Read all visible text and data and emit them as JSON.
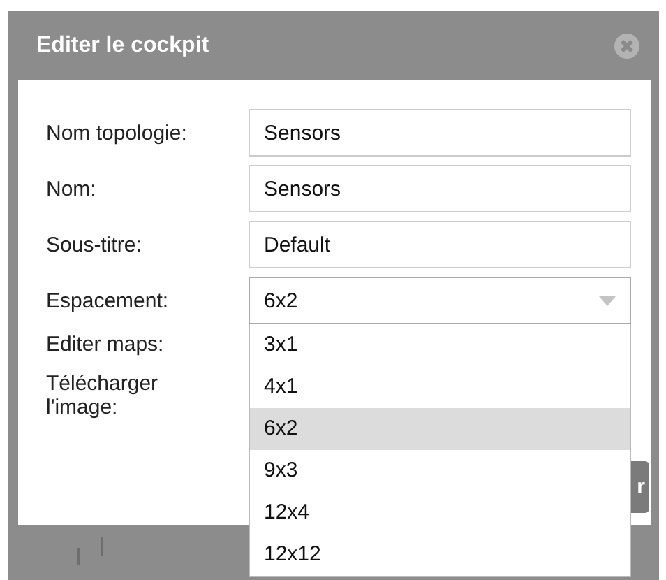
{
  "dialog": {
    "title": "Editer le cockpit",
    "fields": [
      {
        "kind": "text",
        "label": "Nom topologie:",
        "value": "Sensors"
      },
      {
        "kind": "text",
        "label": "Nom:",
        "value": "Sensors"
      },
      {
        "kind": "text",
        "label": "Sous-titre:",
        "value": "Default"
      },
      {
        "kind": "select",
        "label": "Espacement:",
        "value": "6x2",
        "expanded": true,
        "options": [
          {
            "label": "3x1",
            "selected": false
          },
          {
            "label": "4x1",
            "selected": false
          },
          {
            "label": "6x2",
            "selected": true
          },
          {
            "label": "9x3",
            "selected": false
          },
          {
            "label": "12x4",
            "selected": false
          },
          {
            "label": "12x12",
            "selected": false
          }
        ]
      },
      {
        "kind": "label",
        "label": "Editer maps:"
      },
      {
        "kind": "label",
        "label": "Télécharger l'image:"
      }
    ],
    "button": "r"
  }
}
